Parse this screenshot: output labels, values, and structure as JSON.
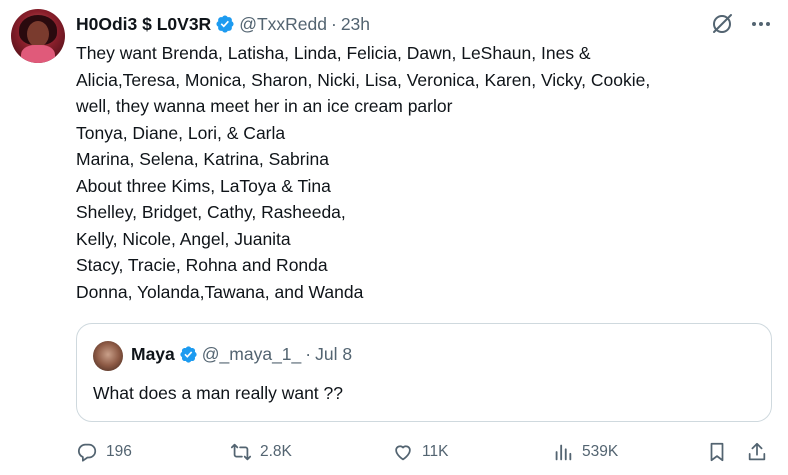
{
  "tweet": {
    "display_name": "H0Odi3 $ L0V3R",
    "handle": "@TxxRedd",
    "time": "23h",
    "separator": "·",
    "lines": [
      "They want Brenda, Latisha, Linda, Felicia, Dawn, LeShaun, Ines &",
      "Alicia,Teresa, Monica, Sharon, Nicki, Lisa, Veronica, Karen, Vicky, Cookie,",
      "well, they wanna meet her in an ice cream parlor",
      "Tonya, Diane, Lori, & Carla",
      "Marina, Selena, Katrina, Sabrina",
      "About three Kims, LaToya & Tina",
      "Shelley, Bridget, Cathy, Rasheeda,",
      "Kelly, Nicole, Angel, Juanita",
      "Stacy, Tracie, Rohna and Ronda",
      "Donna, Yolanda,Tawana, and Wanda"
    ]
  },
  "quote": {
    "display_name": "Maya",
    "handle": "@_maya_1_",
    "separator": "·",
    "time": "Jul 8",
    "text": "What does a man really want ??"
  },
  "actions": {
    "replies": "196",
    "reposts": "2.8K",
    "likes": "11K",
    "views": "539K"
  },
  "icons": {
    "verified": "verified-badge-icon",
    "grok": "grok-icon",
    "more": "more-icon",
    "reply": "reply-icon",
    "repost": "repost-icon",
    "like": "like-icon",
    "views": "views-icon",
    "bookmark": "bookmark-icon",
    "share": "share-icon"
  },
  "colors": {
    "text": "#0f1419",
    "secondary": "#536471",
    "verified": "#1d9bf0",
    "border": "#cfd9de"
  }
}
